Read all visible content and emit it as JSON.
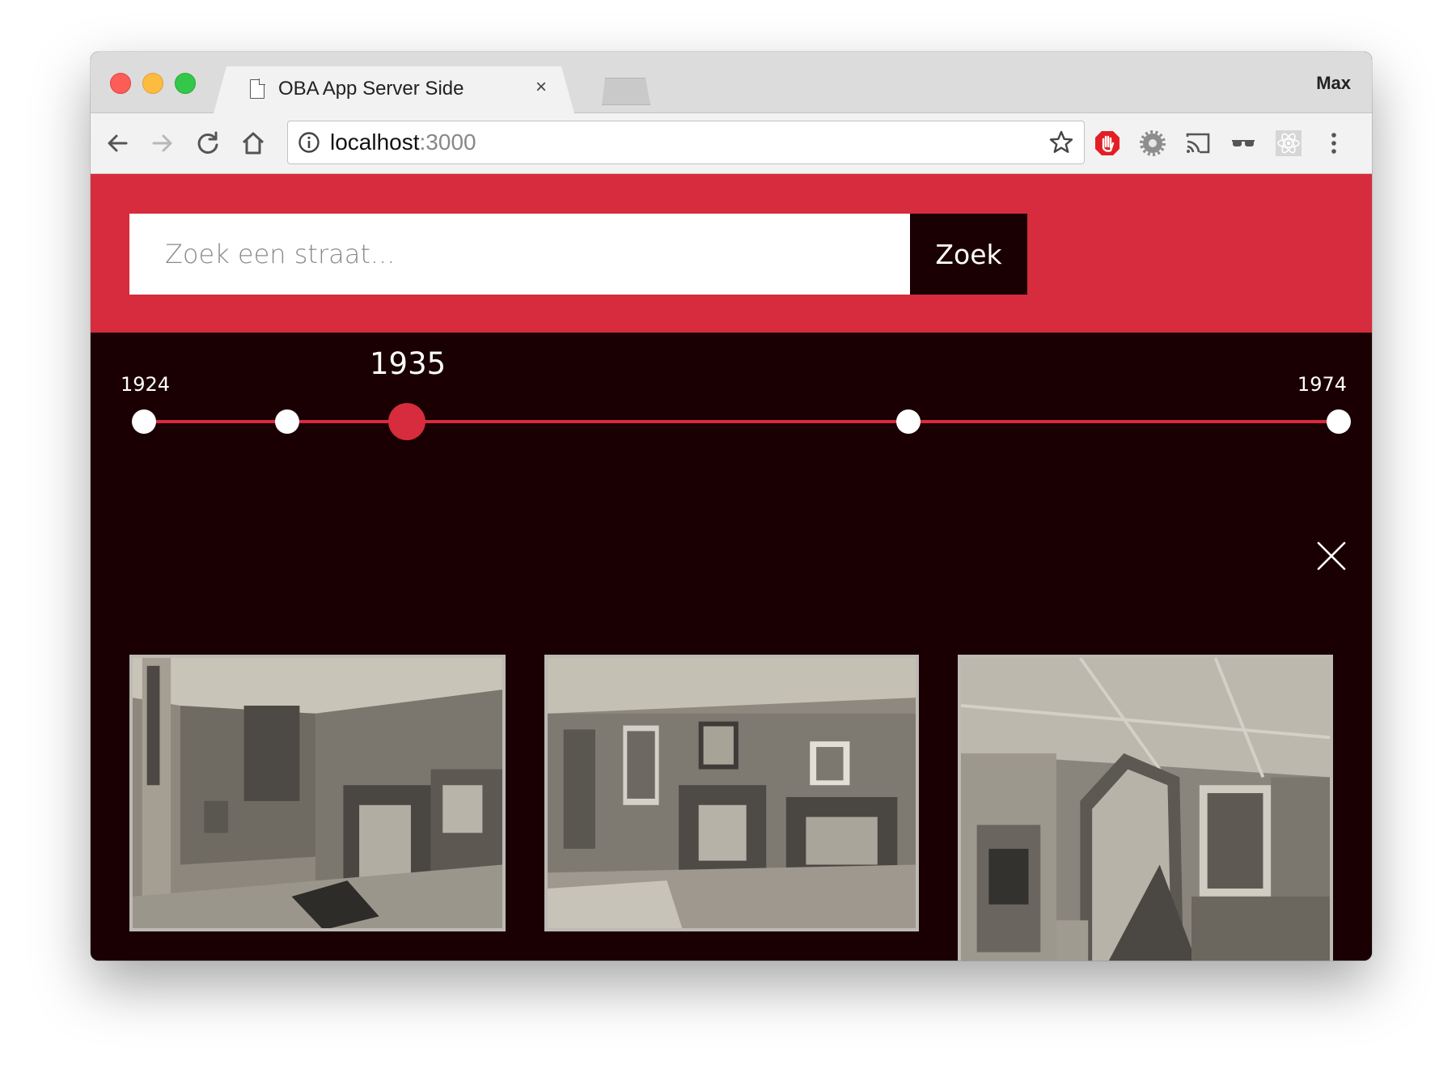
{
  "browser": {
    "tab_title": "OBA App Server Side",
    "tab_close": "×",
    "profile_name": "Max",
    "url_host": "localhost",
    "url_port": ":3000"
  },
  "search": {
    "placeholder": "Zoek een straat...",
    "button_label": "Zoek"
  },
  "timeline": {
    "start_year": "1924",
    "end_year": "1974",
    "active_year": "1935",
    "points": [
      {
        "year": 1924,
        "active": false
      },
      {
        "year": 1930,
        "active": false
      },
      {
        "year": 1935,
        "active": true
      },
      {
        "year": 1956,
        "active": false
      },
      {
        "year": 1974,
        "active": false
      }
    ]
  },
  "results": {
    "photos": [
      {
        "subject": "interior-fireplace-tiled-room"
      },
      {
        "subject": "interior-room-two-fireplaces"
      },
      {
        "subject": "interior-hall-staircase-arch"
      }
    ]
  },
  "colors": {
    "brand_red": "#d62c3e",
    "page_dark": "#1a0003"
  }
}
